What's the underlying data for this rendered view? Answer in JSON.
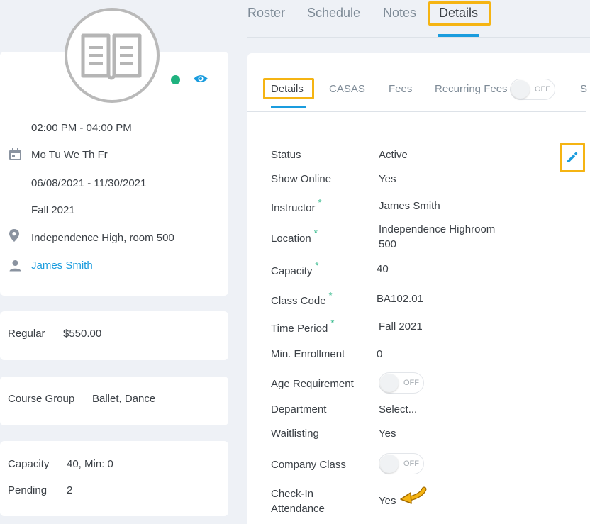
{
  "top_tabs": [
    {
      "label": "Roster"
    },
    {
      "label": "Schedule"
    },
    {
      "label": "Notes"
    },
    {
      "label": "Details",
      "active": true
    }
  ],
  "class_card": {
    "status_color": "#1fb27f",
    "time": "02:00 PM - 04:00 PM",
    "days": "Mo Tu We Th Fr",
    "dates": "06/08/2021 - 11/30/2021",
    "term": "Fall 2021",
    "location": "Independence High, room 500",
    "instructor": "James Smith"
  },
  "fee_card": {
    "label": "Regular",
    "amount": "$550.00"
  },
  "group_card": {
    "label": "Course Group",
    "value": "Ballet, Dance"
  },
  "capacity_card": {
    "capacity_label": "Capacity",
    "capacity_value": "40, Min: 0",
    "pending_label": "Pending",
    "pending_value": "2"
  },
  "sub_tabs": [
    {
      "label": "Details",
      "active": true
    },
    {
      "label": "CASAS"
    },
    {
      "label": "Fees"
    },
    {
      "label": "Recurring Fees"
    },
    {
      "label": "S"
    }
  ],
  "toggle_off_label": "OFF",
  "details": {
    "status": {
      "label": "Status",
      "value": "Active"
    },
    "show_online": {
      "label": "Show Online",
      "value": "Yes"
    },
    "instructor": {
      "label": "Instructor",
      "value": "James Smith"
    },
    "location": {
      "label": "Location",
      "value_line1": "Independence Highroom",
      "value_line2": "500"
    },
    "capacity": {
      "label": "Capacity",
      "value": "40"
    },
    "class_code": {
      "label": "Class Code",
      "value": "BA102.01"
    },
    "time_period": {
      "label": "Time Period",
      "value": "Fall 2021"
    },
    "min_enrollment": {
      "label": "Min. Enrollment",
      "value": "0"
    },
    "age_requirement": {
      "label": "Age Requirement"
    },
    "department": {
      "label": "Department",
      "value": "Select..."
    },
    "waitlisting": {
      "label": "Waitlisting",
      "value": "Yes"
    },
    "company_class": {
      "label": "Company Class"
    },
    "check_in": {
      "label_line1": "Check-In",
      "label_line2": "Attendance",
      "value": "Yes"
    }
  },
  "colors": {
    "accent": "#1a9cde",
    "highlight": "#f5b413",
    "success": "#1fb27f"
  }
}
